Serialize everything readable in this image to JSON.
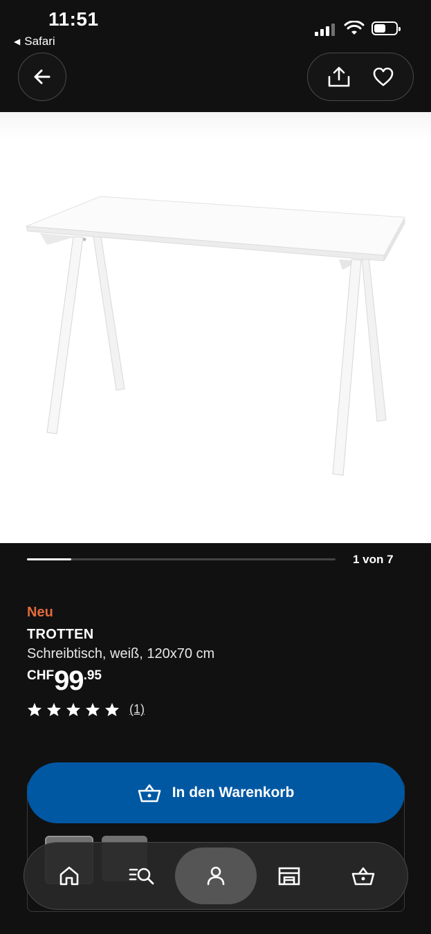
{
  "status_bar": {
    "time": "11:51",
    "back_app": "Safari"
  },
  "top_nav": {
    "back_icon": "arrow-left-icon",
    "share_icon": "share-icon",
    "favorite_icon": "heart-icon"
  },
  "gallery": {
    "counter": "1 von 7",
    "current": 1,
    "total": 7
  },
  "product": {
    "badge": "Neu",
    "name": "TROTTEN",
    "description": "Schreibtisch, weiß, 120x70 cm",
    "price": {
      "currency": "CHF",
      "integer": "99",
      "decimal": ".95"
    },
    "rating": {
      "stars": 5,
      "max": 5,
      "count_text": "(1)"
    }
  },
  "cart_button": {
    "label": "In den Warenkorb",
    "icon": "basket-icon"
  },
  "bottom_nav": {
    "items": [
      {
        "name": "home",
        "icon": "home-icon"
      },
      {
        "name": "search",
        "icon": "search-list-icon"
      },
      {
        "name": "profile",
        "icon": "person-icon",
        "active": true
      },
      {
        "name": "stores",
        "icon": "store-icon"
      },
      {
        "name": "cart",
        "icon": "basket-icon"
      }
    ]
  },
  "colors": {
    "background": "#111111",
    "accent": "#0058a3",
    "badge": "#e36b3c"
  }
}
